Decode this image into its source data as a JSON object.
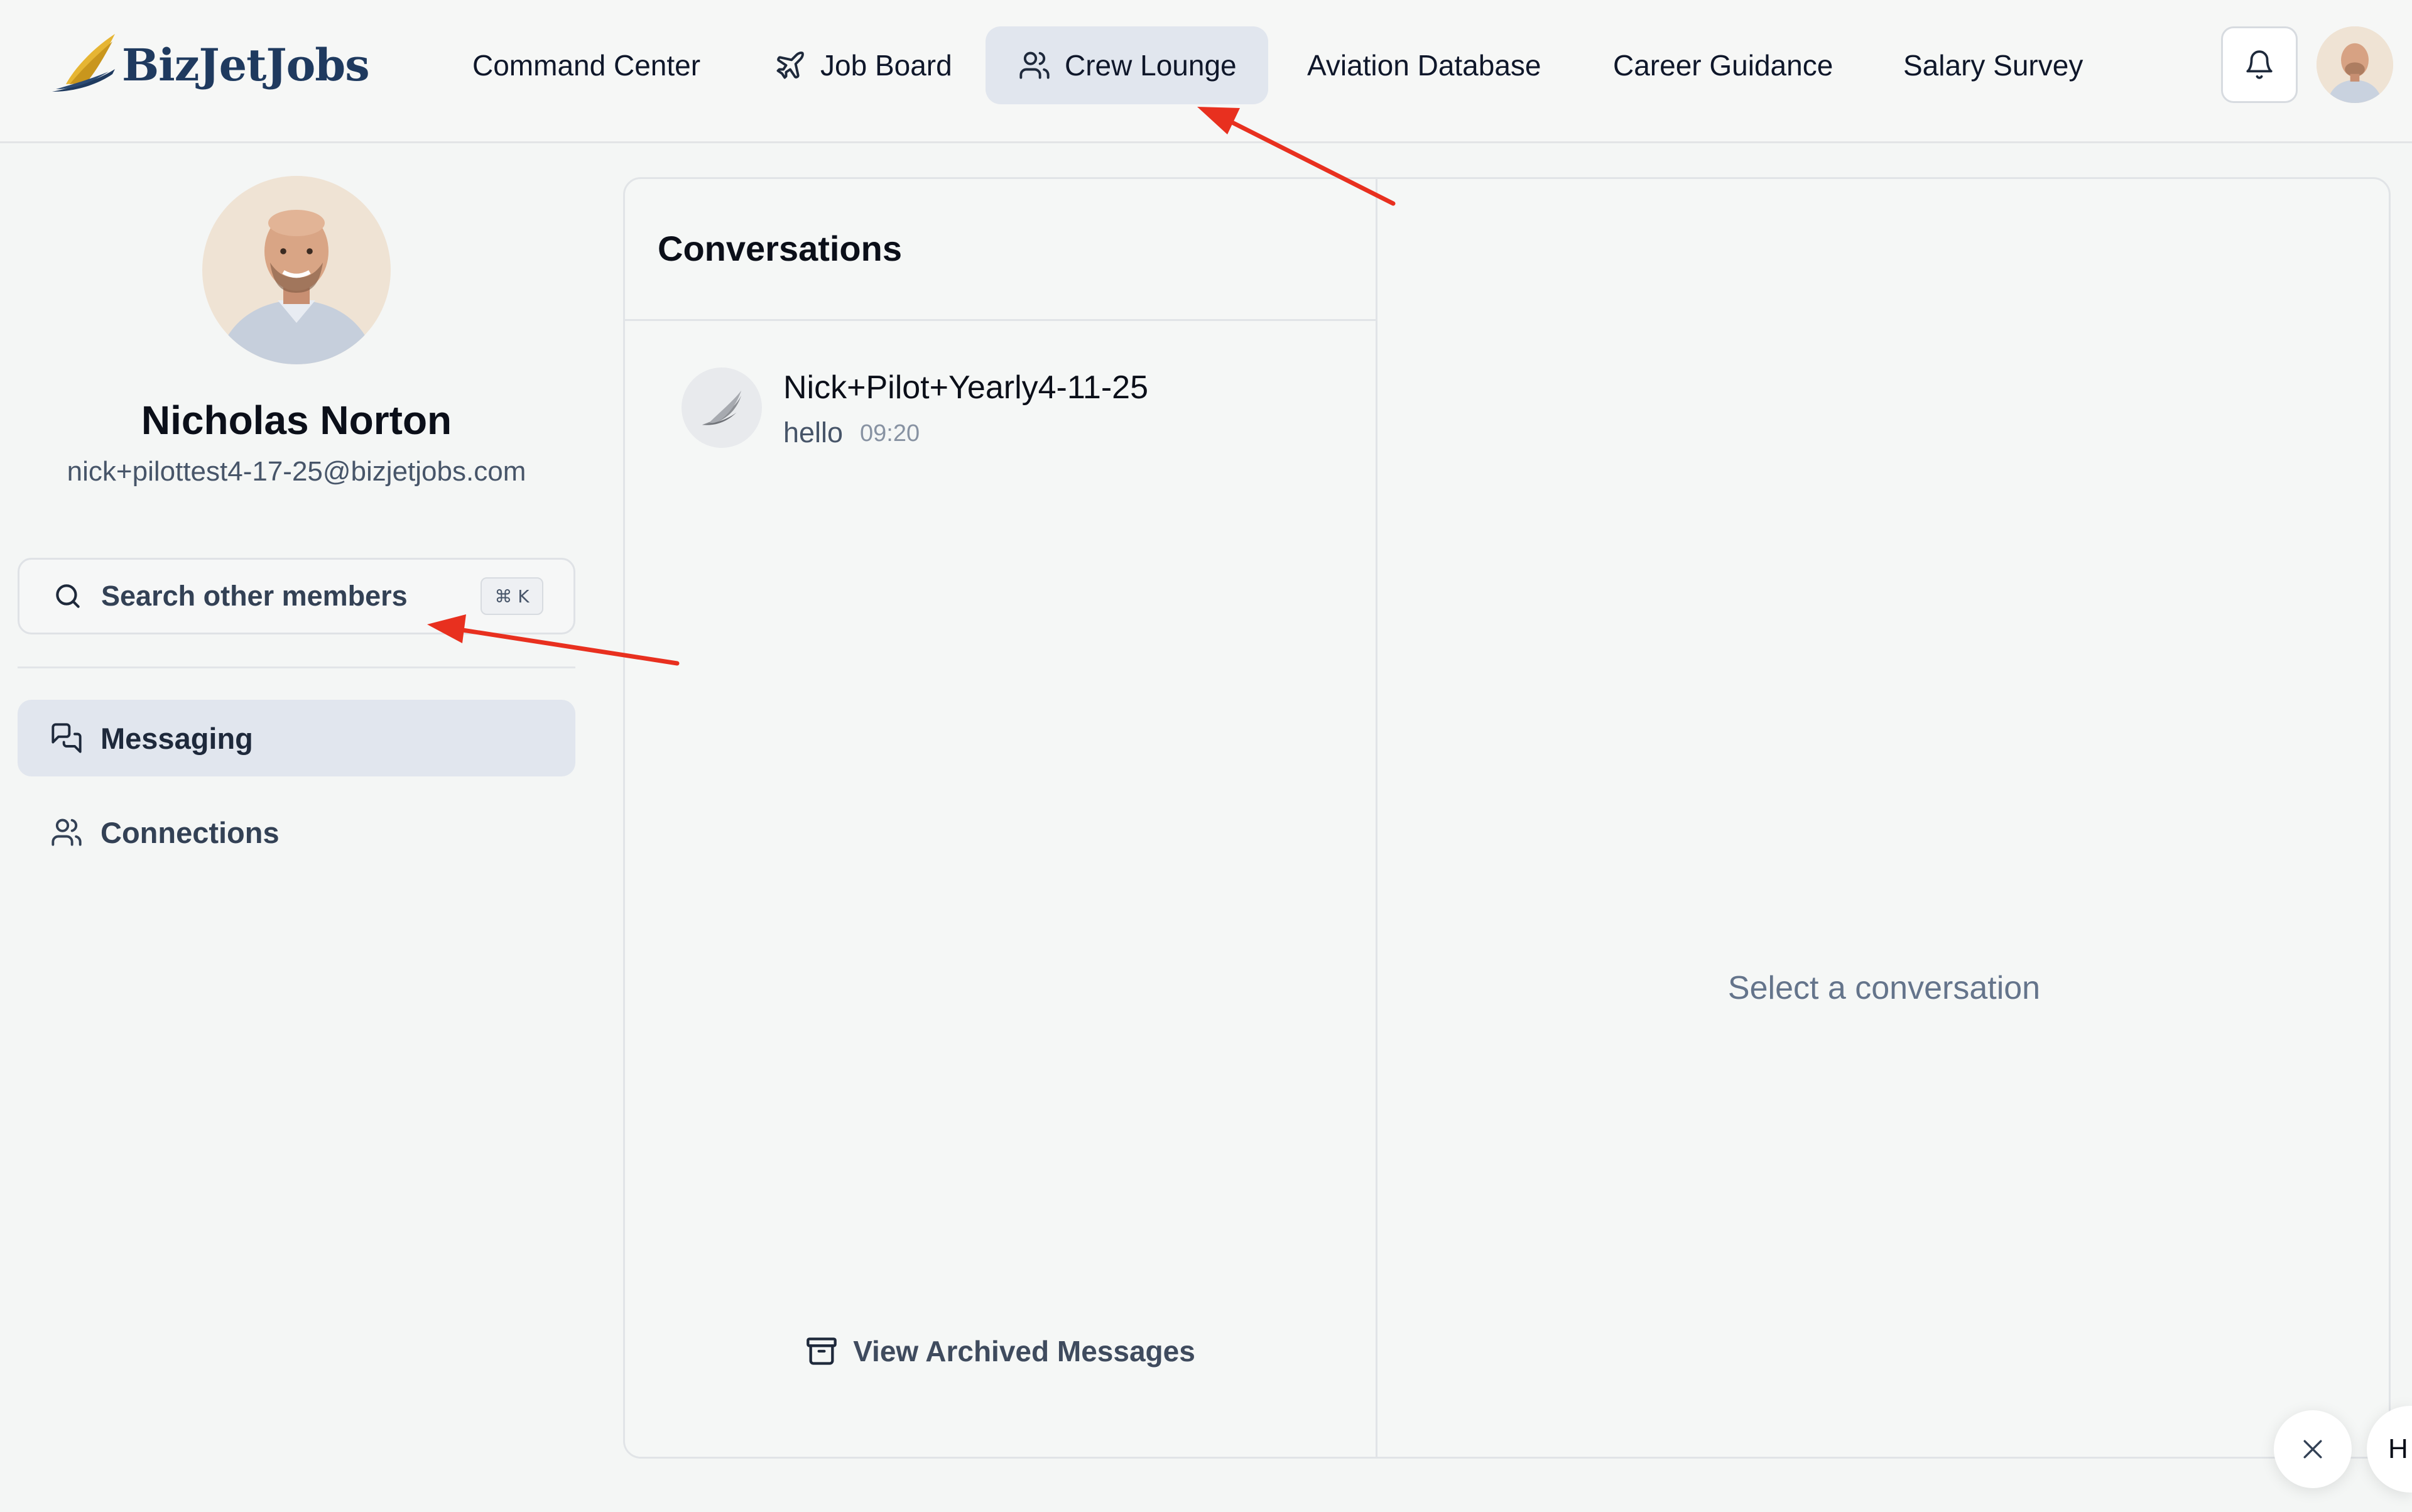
{
  "header": {
    "brand": "BizJetJobs",
    "nav": [
      {
        "label": "Command Center",
        "icon": ""
      },
      {
        "label": "Job Board",
        "icon": "plane-icon"
      },
      {
        "label": "Crew Lounge",
        "icon": "users-icon",
        "active": true
      },
      {
        "label": "Aviation Database",
        "icon": ""
      },
      {
        "label": "Career Guidance",
        "icon": ""
      },
      {
        "label": "Salary Survey",
        "icon": ""
      }
    ],
    "icons": {
      "notifications": "bell-icon",
      "profile": "avatar"
    }
  },
  "sidebar": {
    "profile": {
      "name": "Nicholas Norton",
      "email": "nick+pilottest4-17-25@bizjetjobs.com"
    },
    "search": {
      "placeholder": "Search other members",
      "shortcut": "⌘ K"
    },
    "items": [
      {
        "label": "Messaging",
        "icon": "messages-icon",
        "active": true
      },
      {
        "label": "Connections",
        "icon": "users-icon",
        "active": false
      }
    ]
  },
  "conversations": {
    "title": "Conversations",
    "items": [
      {
        "name": "Nick+Pilot+Yearly4-11-25",
        "preview": "hello",
        "time": "09:20"
      }
    ],
    "archived_label": "View Archived Messages"
  },
  "detail": {
    "empty_text": "Select a conversation"
  },
  "widget": {
    "bubble_text": "H"
  },
  "colors": {
    "accent_bg": "#e1e6ee",
    "brand_navy": "#1f3a5f",
    "brand_gold": "#e6b533",
    "annotation_red": "#e8301f"
  }
}
